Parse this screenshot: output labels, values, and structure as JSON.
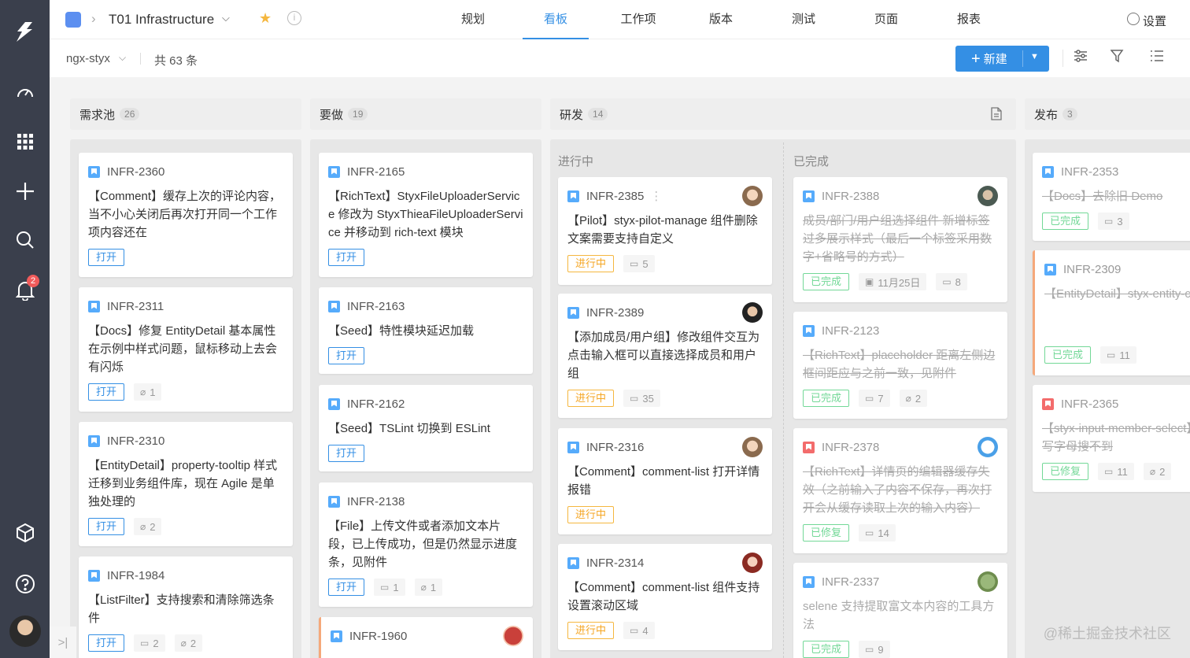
{
  "topbar": {
    "project_name": "T01 Infrastructure",
    "nav_tabs": [
      "规划",
      "看板",
      "工作项",
      "版本",
      "测试",
      "页面",
      "报表"
    ],
    "active_tab": "看板",
    "settings_label": "设置"
  },
  "subbar": {
    "repo": "ngx-styx",
    "total": "共 63 条",
    "new_label": "新建"
  },
  "rail": {
    "notification_count": "2"
  },
  "columns": [
    {
      "name": "需求池",
      "count": "26"
    },
    {
      "name": "要做",
      "count": "19"
    },
    {
      "name": "研发",
      "count": "14"
    },
    {
      "name": "发布",
      "count": "3"
    }
  ],
  "dev_subcolumns": [
    "进行中",
    "已完成"
  ],
  "cards": {
    "backlog": [
      {
        "id": "INFR-2360",
        "title": "【Comment】缓存上次的评论内容，当不小心关闭后再次打开同一个工作项内容还在",
        "status": "打开"
      },
      {
        "id": "INFR-2311",
        "title": "【Docs】修复 EntityDetail 基本属性在示例中样式问题，鼠标移动上去会有闪烁",
        "status": "打开",
        "attach": "1"
      },
      {
        "id": "INFR-2310",
        "title": "【EntityDetail】property-tooltip 样式迁移到业务组件库，现在 Agile 是单独处理的",
        "status": "打开",
        "attach": "2"
      },
      {
        "id": "INFR-1984",
        "title": "【ListFilter】支持搜索和清除筛选条件",
        "status": "打开",
        "comments": "2",
        "attach": "2"
      }
    ],
    "todo": [
      {
        "id": "INFR-2165",
        "title": "【RichText】StyxFileUploaderService 修改为 StyxThieaFileUploaderService 并移动到 rich-text 模块",
        "status": "打开"
      },
      {
        "id": "INFR-2163",
        "title": "【Seed】特性模块延迟加载",
        "status": "打开"
      },
      {
        "id": "INFR-2162",
        "title": "【Seed】TSLint 切换到 ESLint",
        "status": "打开"
      },
      {
        "id": "INFR-2138",
        "title": "【File】上传文件或者添加文本片段，已上传成功，但是仍然显示进度条，见附件",
        "status": "打开",
        "comments": "1",
        "attach": "1"
      },
      {
        "id": "INFR-1960",
        "title": ""
      }
    ],
    "dev_doing": [
      {
        "id": "INFR-2385",
        "title": "【Pilot】styx-pilot-manage 组件删除文案需要支持自定义",
        "status": "进行中",
        "comments": "5"
      },
      {
        "id": "INFR-2389",
        "title": "【添加成员/用户组】修改组件交互为点击输入框可以直接选择成员和用户组",
        "status": "进行中",
        "comments": "35"
      },
      {
        "id": "INFR-2316",
        "title": "【Comment】comment-list 打开详情报错",
        "status": "进行中"
      },
      {
        "id": "INFR-2314",
        "title": "【Comment】comment-list 组件支持设置滚动区域",
        "status": "进行中",
        "comments": "4"
      }
    ],
    "dev_done": [
      {
        "id": "INFR-2388",
        "title": "成员/部门/用户组选择组件 新增标签过多展示样式（最后一个标签采用数字+省略号的方式）",
        "status": "已完成",
        "date": "11月25日",
        "comments": "8"
      },
      {
        "id": "INFR-2123",
        "title": "【RichText】placeholder 距离左侧边框间距应与之前一致，见附件",
        "status": "已完成",
        "comments": "7",
        "attach": "2"
      },
      {
        "id": "INFR-2378",
        "title": "【RichText】详情页的编辑器缓存失效（之前输入了内容不保存，再次打开会从缓存读取上次的输入内容）",
        "status": "已修复",
        "comments": "14"
      },
      {
        "id": "INFR-2337",
        "title": "selene 支持提取富文本内容的工具方法",
        "status": "已完成",
        "comments": "9"
      }
    ],
    "release": [
      {
        "id": "INFR-2353",
        "title": "【Docs】去除旧 Demo",
        "status": "已完成",
        "comments": "3"
      },
      {
        "id": "INFR-2309",
        "title": "【EntityDetail】styx-entity-creator 组件中 styxCreatedBy UpdatedBy 支持直接传 UID",
        "status": "已完成",
        "comments": "11"
      },
      {
        "id": "INFR-2365",
        "title": "【styx-input-member-select】大写字母搜不到",
        "status": "已修复",
        "comments": "11",
        "attach": "2"
      }
    ]
  },
  "watermark": "@稀土掘金技术社区",
  "colors": {
    "rail": "#3a3f4c",
    "accent": "#348fe4",
    "doing": "#f5a623",
    "done": "#73d897"
  }
}
